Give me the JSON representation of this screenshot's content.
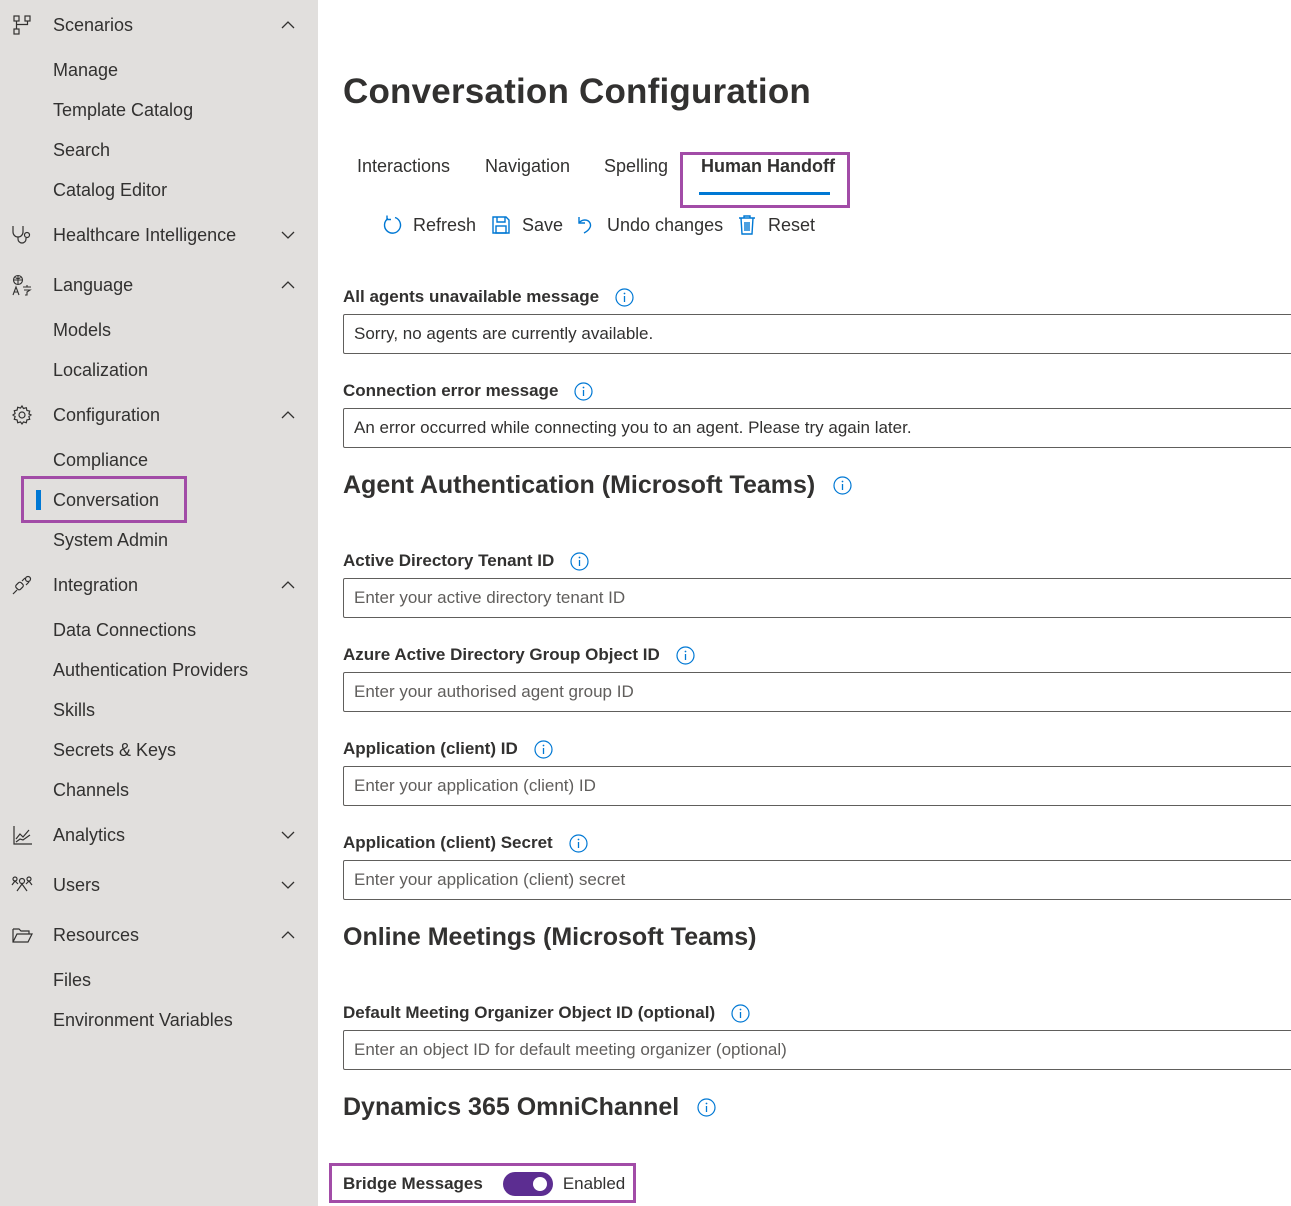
{
  "sidebar": {
    "groups": [
      {
        "label": "Scenarios",
        "icon": "flow-icon",
        "expanded": true,
        "items": [
          "Manage",
          "Template Catalog",
          "Search",
          "Catalog Editor"
        ]
      },
      {
        "label": "Healthcare Intelligence",
        "icon": "stethoscope-icon",
        "expanded": false,
        "items": []
      },
      {
        "label": "Language",
        "icon": "translate-icon",
        "expanded": true,
        "items": [
          "Models",
          "Localization"
        ]
      },
      {
        "label": "Configuration",
        "icon": "gear-icon",
        "expanded": true,
        "items": [
          "Compliance",
          "Conversation",
          "System Admin"
        ]
      },
      {
        "label": "Integration",
        "icon": "plug-icon",
        "expanded": true,
        "items": [
          "Data Connections",
          "Authentication Providers",
          "Skills",
          "Secrets & Keys",
          "Channels"
        ]
      },
      {
        "label": "Analytics",
        "icon": "chart-icon",
        "expanded": false,
        "items": []
      },
      {
        "label": "Users",
        "icon": "users-icon",
        "expanded": false,
        "items": []
      },
      {
        "label": "Resources",
        "icon": "folder-icon",
        "expanded": true,
        "items": [
          "Files",
          "Environment Variables"
        ]
      }
    ],
    "active_item": "Conversation"
  },
  "page": {
    "title": "Conversation Configuration",
    "tabs": [
      {
        "label": "Interactions",
        "active": false
      },
      {
        "label": "Navigation",
        "active": false
      },
      {
        "label": "Spelling",
        "active": false
      },
      {
        "label": "Human Handoff",
        "active": true
      }
    ],
    "toolbar": {
      "refresh": "Refresh",
      "save": "Save",
      "undo": "Undo changes",
      "reset": "Reset"
    },
    "fields": {
      "all_agents_unavailable": {
        "label": "All agents unavailable message",
        "value": "Sorry, no agents are currently available.",
        "placeholder": ""
      },
      "connection_error": {
        "label": "Connection error message",
        "value": "An error occurred while connecting you to an agent. Please try again later.",
        "placeholder": ""
      },
      "tenant_id": {
        "label": "Active Directory Tenant ID",
        "value": "",
        "placeholder": "Enter your active directory tenant ID"
      },
      "group_object_id": {
        "label": "Azure Active Directory Group Object ID",
        "value": "",
        "placeholder": "Enter your authorised agent group ID"
      },
      "client_id": {
        "label": "Application (client) ID",
        "value": "",
        "placeholder": "Enter your application (client) ID"
      },
      "client_secret": {
        "label": "Application (client) Secret",
        "value": "",
        "placeholder": "Enter your application (client) secret"
      },
      "meeting_organizer": {
        "label": "Default Meeting Organizer Object ID (optional)",
        "value": "",
        "placeholder": "Enter an object ID for default meeting organizer (optional)"
      }
    },
    "sections": {
      "agent_auth": "Agent Authentication (Microsoft Teams)",
      "online_meetings": "Online Meetings (Microsoft Teams)",
      "omnichannel": "Dynamics 365 OmniChannel"
    },
    "bridge_messages": {
      "label": "Bridge Messages",
      "enabled": true,
      "state_text": "Enabled"
    }
  },
  "colors": {
    "accent": "#0078d4",
    "highlight": "#a24ca7",
    "toggle_on": "#5c2d91",
    "sidebar_bg": "#e1dfdd"
  }
}
